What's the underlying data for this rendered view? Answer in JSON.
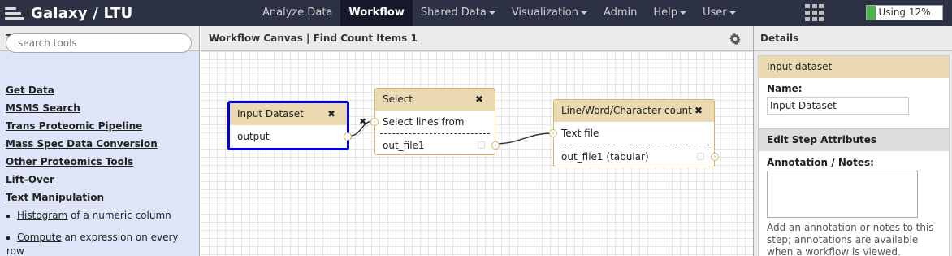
{
  "masthead": {
    "brand": "Galaxy / LTU",
    "nav": [
      {
        "label": "Analyze Data",
        "dropdown": false,
        "active": false
      },
      {
        "label": "Workflow",
        "dropdown": false,
        "active": true
      },
      {
        "label": "Shared Data",
        "dropdown": true,
        "active": false
      },
      {
        "label": "Visualization",
        "dropdown": true,
        "active": false
      },
      {
        "label": "Admin",
        "dropdown": false,
        "active": false
      },
      {
        "label": "Help",
        "dropdown": true,
        "active": false
      },
      {
        "label": "User",
        "dropdown": true,
        "active": false
      }
    ],
    "quota": {
      "label": "Using 12%",
      "percent": 12
    }
  },
  "tools": {
    "title": "Tools",
    "search_placeholder": "search tools",
    "sections": [
      "Get Data",
      "MSMS Search",
      "Trans Proteomic Pipeline",
      "Mass Spec Data Conversion",
      "Other Proteomics Tools",
      "Lift-Over",
      "Text Manipulation"
    ],
    "items": [
      {
        "link": "Histogram",
        "text": " of a numeric column"
      },
      {
        "link": "Compute",
        "text": " an expression on every row"
      }
    ]
  },
  "canvas": {
    "title": "Workflow Canvas | Find Count Items 1",
    "nodes": {
      "input": {
        "title": "Input Dataset",
        "output": "output"
      },
      "select": {
        "title": "Select",
        "input": "Select lines from",
        "output": "out_file1"
      },
      "count": {
        "title": "Line/Word/Character count",
        "input": "Text file",
        "output": "out_file1 (tabular)"
      }
    }
  },
  "details": {
    "title": "Details",
    "input_box": {
      "title": "Input dataset",
      "name_label": "Name:",
      "name_value": "Input Dataset"
    },
    "step_box": {
      "title": "Edit Step Attributes",
      "notes_label": "Annotation / Notes:",
      "help": "Add an annotation or notes to this step; annotations are available when a workflow is viewed."
    }
  },
  "colors": {
    "masthead": "#2c3143",
    "tool_panel": "#dfe5f9",
    "node_title": "#ebd9b2",
    "selected_border": "#0000dd",
    "quota_fill": "#4db34d"
  }
}
